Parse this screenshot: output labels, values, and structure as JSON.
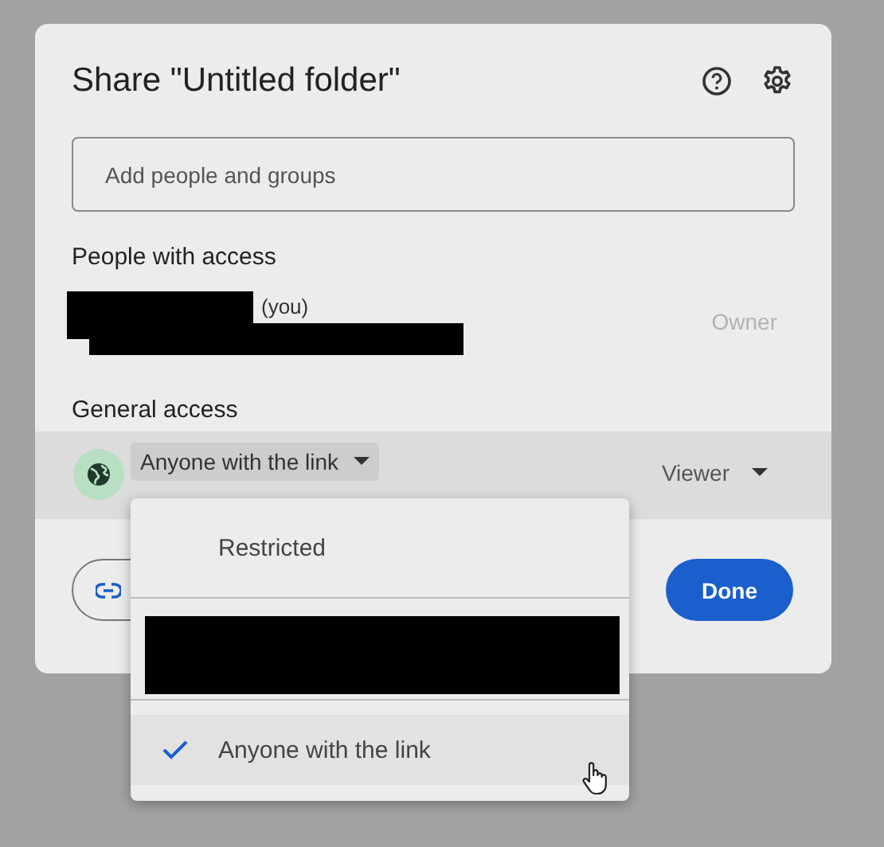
{
  "dialog": {
    "title": "Share \"Untitled folder\"",
    "search": {
      "placeholder": "Add people and groups"
    },
    "people_heading": "People with access",
    "people": [
      {
        "suffix": "(you)",
        "role": "Owner"
      }
    ],
    "general_heading": "General access",
    "access": {
      "value": "Anyone with the link",
      "role": "Viewer"
    },
    "done_button": "Done"
  },
  "menu": {
    "items": [
      {
        "kind": "option",
        "label": "Restricted",
        "selected": false
      },
      {
        "kind": "redacted"
      },
      {
        "kind": "option",
        "label": "Anyone with the link",
        "selected": true
      }
    ]
  }
}
